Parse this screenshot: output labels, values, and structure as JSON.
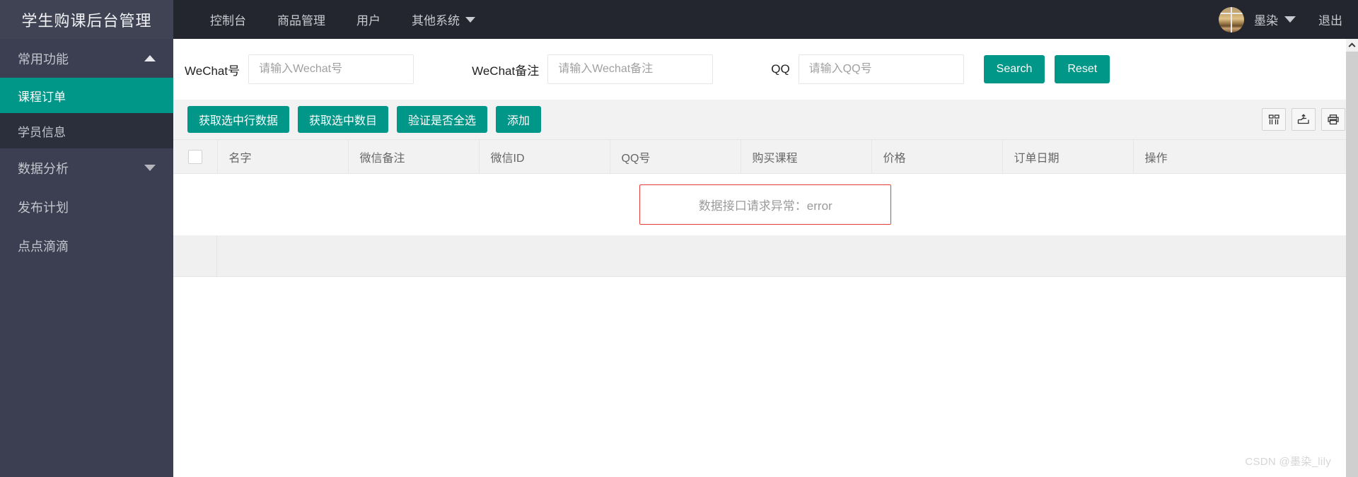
{
  "sidebar": {
    "logo_title": "学生购课后台管理",
    "groups": [
      {
        "label": "常用功能",
        "icon": "caret-up-icon",
        "expanded": true
      },
      {
        "label": "数据分析",
        "icon": "caret-down-icon",
        "expanded": false
      }
    ],
    "items": [
      {
        "label": "课程订单",
        "active": true
      },
      {
        "label": "学员信息",
        "active": false
      },
      {
        "label": "发布计划",
        "active": false
      },
      {
        "label": "点点滴滴",
        "active": false
      }
    ],
    "active_color": "#009688",
    "bg_color": "#3b3f51"
  },
  "topbar": {
    "nav": [
      {
        "label": "控制台",
        "has_caret": false
      },
      {
        "label": "商品管理",
        "has_caret": false
      },
      {
        "label": "用户",
        "has_caret": false
      },
      {
        "label": "其他系统",
        "has_caret": true
      }
    ],
    "user_name": "墨染",
    "logout_label": "退出",
    "bg_color": "#24262f"
  },
  "search": {
    "fields": [
      {
        "label": "WeChat号",
        "placeholder": "请输入Wechat号",
        "value": ""
      },
      {
        "label": "WeChat备注",
        "placeholder": "请输入Wechat备注",
        "value": ""
      },
      {
        "label": "QQ",
        "placeholder": "请输入QQ号",
        "value": ""
      }
    ],
    "search_label": "Search",
    "reset_label": "Reset"
  },
  "toolbar": {
    "buttons": [
      {
        "label": "获取选中行数据"
      },
      {
        "label": "获取选中数目"
      },
      {
        "label": "验证是否全选"
      },
      {
        "label": "添加"
      }
    ],
    "icons": [
      {
        "name": "column-toggle-icon"
      },
      {
        "name": "export-icon"
      },
      {
        "name": "print-icon"
      }
    ]
  },
  "table": {
    "columns": [
      {
        "key": "select",
        "label": ""
      },
      {
        "key": "name",
        "label": "名字"
      },
      {
        "key": "wechat_remark",
        "label": "微信备注"
      },
      {
        "key": "wechat_id",
        "label": "微信ID"
      },
      {
        "key": "qq",
        "label": "QQ号"
      },
      {
        "key": "course",
        "label": "购买课程"
      },
      {
        "key": "price",
        "label": "价格"
      },
      {
        "key": "order_date",
        "label": "订单日期"
      },
      {
        "key": "action",
        "label": "操作"
      }
    ],
    "rows": [],
    "empty_message": "数据接口请求异常：error",
    "empty_border_color": "#e8413b"
  },
  "watermark": "CSDN @墨染_lily"
}
